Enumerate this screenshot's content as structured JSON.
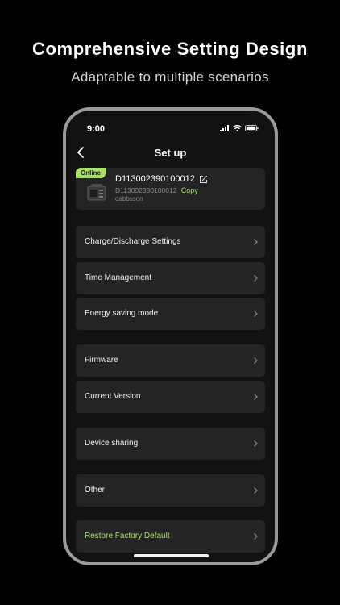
{
  "promo": {
    "headline": "Comprehensive Setting Design",
    "subline": "Adaptable to multiple scenarios"
  },
  "status_bar": {
    "time": "9:00",
    "icons": [
      "signal-icon",
      "wifi-icon",
      "battery-icon"
    ]
  },
  "nav": {
    "title": "Set up",
    "back_icon": "chevron-left-icon"
  },
  "device": {
    "status": "Online",
    "name": "D113002390100012",
    "serial": "D113002390100012",
    "copy_label": "Copy",
    "owner": "dabbsson",
    "edit_icon": "edit-icon"
  },
  "menu": {
    "charge_discharge": "Charge/Discharge Settings",
    "time_management": "Time Management",
    "energy_saving": "Energy saving mode",
    "firmware": "Firmware",
    "current_version": "Current Version",
    "device_sharing": "Device sharing",
    "other": "Other",
    "restore": "Restore Factory Default"
  },
  "colors": {
    "accent": "#a8e06b",
    "card": "#242424",
    "background": "#121212"
  }
}
